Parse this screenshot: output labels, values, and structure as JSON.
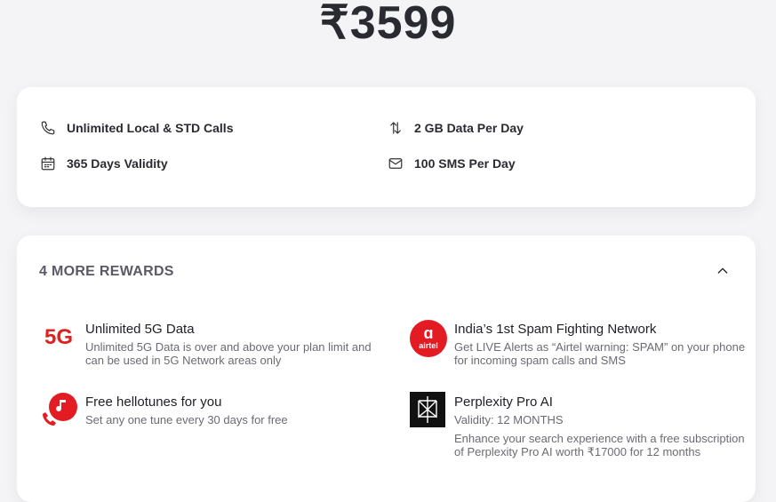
{
  "price": "₹3599",
  "benefits": [
    {
      "label": "Unlimited Local & STD Calls",
      "icon": "phone-icon"
    },
    {
      "label": "2 GB Data Per Day",
      "icon": "data-arrows-icon"
    },
    {
      "label": "365 Days Validity",
      "icon": "calendar-icon"
    },
    {
      "label": "100 SMS Per Day",
      "icon": "mail-icon"
    }
  ],
  "rewards": {
    "header": "4 MORE REWARDS",
    "items": [
      {
        "icon_text": "5G",
        "title": "Unlimited 5G Data",
        "desc": "Unlimited 5G Data is over and above your plan limit and can be used in 5G Network areas only"
      },
      {
        "icon_text": "airtel",
        "title": "India’s 1st Spam Fighting Network",
        "desc": "Get LIVE Alerts as “Airtel warning: SPAM” on your phone for incoming spam calls and SMS"
      },
      {
        "title": "Free hellotunes for you",
        "desc": "Set any one tune every 30 days for free"
      },
      {
        "title": "Perplexity Pro AI",
        "desc": "Validity: 12 MONTHS",
        "desc2": "Enhance your search experience with a free subscription of Perplexity Pro AI worth ₹17000 for 12 months"
      }
    ]
  },
  "colors": {
    "accent_red": "#e02020",
    "airtel_red": "#e31b23"
  }
}
